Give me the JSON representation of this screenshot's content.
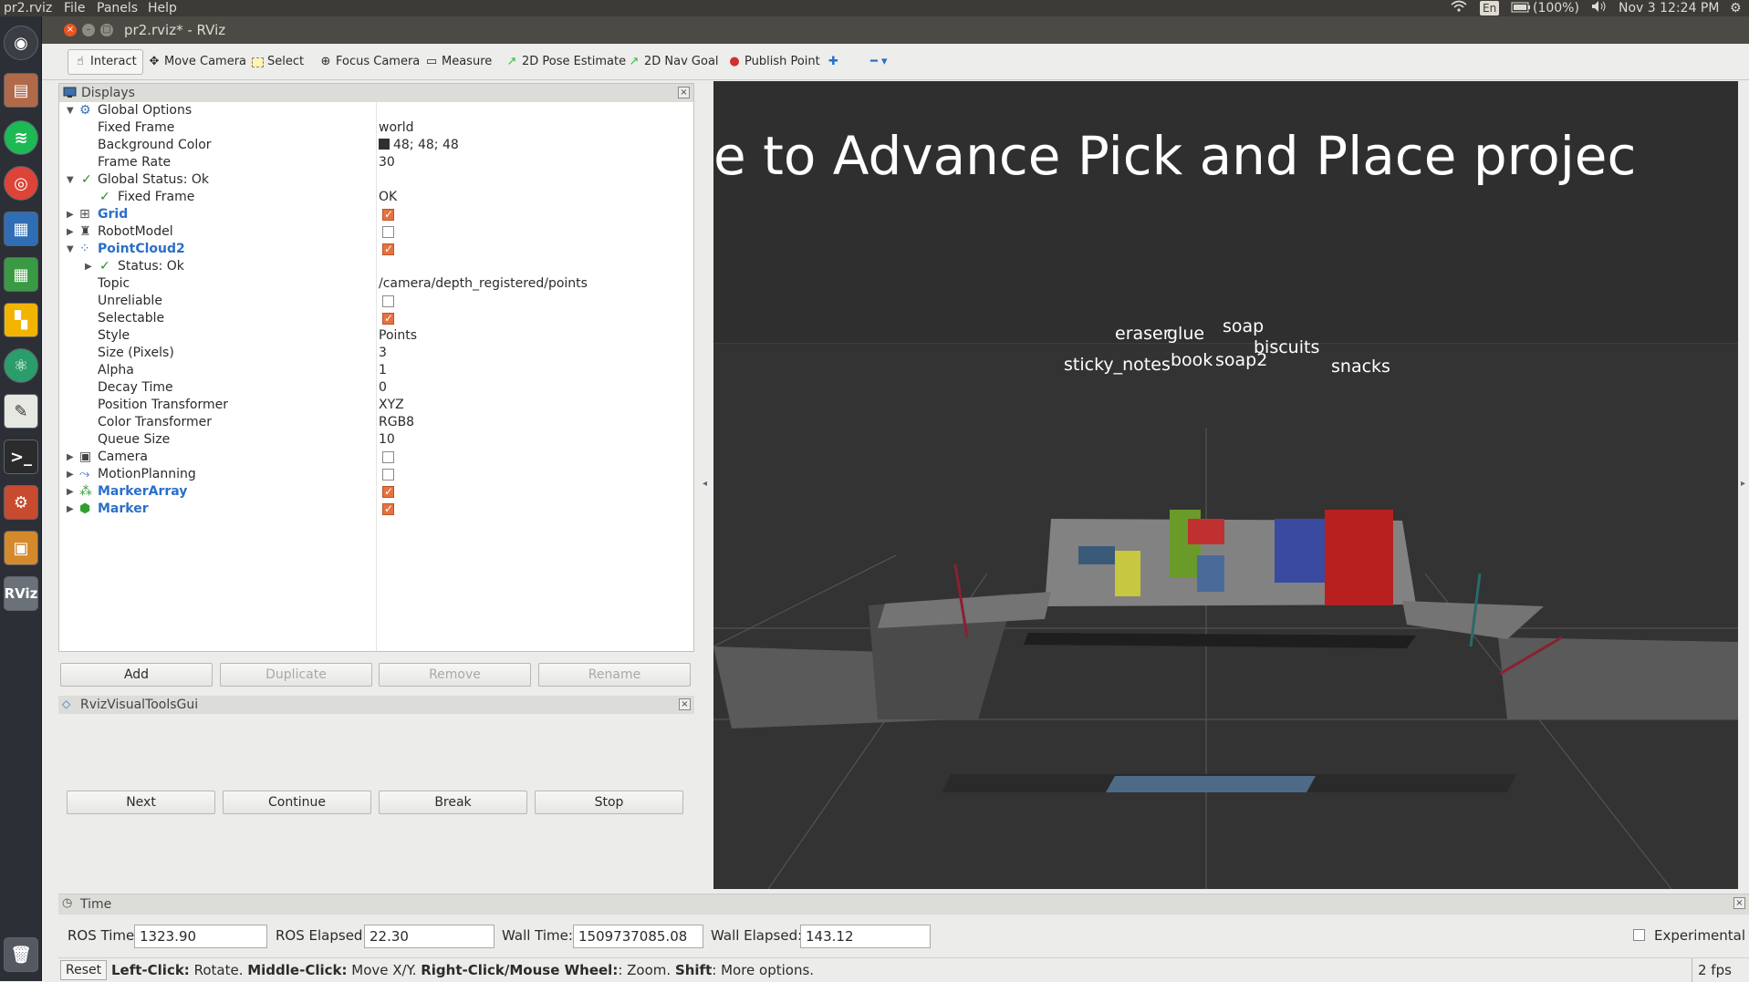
{
  "topbar": {
    "app_name": "pr2.rviz",
    "menus": [
      "File",
      "Panels",
      "Help"
    ],
    "keyboard": "En",
    "battery": "(100%)",
    "datetime": "Nov 3 12:24 PM"
  },
  "window": {
    "title": "pr2.rviz* - RViz"
  },
  "toolbar": {
    "interact": "Interact",
    "move_camera": "Move Camera",
    "select": "Select",
    "focus_camera": "Focus Camera",
    "measure": "Measure",
    "pose_estimate": "2D Pose Estimate",
    "nav_goal": "2D Nav Goal",
    "publish_point": "Publish Point"
  },
  "displays": {
    "header": "Displays",
    "rows": [
      {
        "name": "Global Options",
        "value": ""
      },
      {
        "name": "Fixed Frame",
        "value": "world"
      },
      {
        "name": "Background Color",
        "value": "48; 48; 48"
      },
      {
        "name": "Frame Rate",
        "value": "30"
      },
      {
        "name": "Global Status: Ok",
        "value": ""
      },
      {
        "name": "Fixed Frame",
        "value": "OK"
      },
      {
        "name": "Grid",
        "value": ""
      },
      {
        "name": "RobotModel",
        "value": ""
      },
      {
        "name": "PointCloud2",
        "value": ""
      },
      {
        "name": "Status: Ok",
        "value": ""
      },
      {
        "name": "Topic",
        "value": "/camera/depth_registered/points"
      },
      {
        "name": "Unreliable",
        "value": ""
      },
      {
        "name": "Selectable",
        "value": ""
      },
      {
        "name": "Style",
        "value": "Points"
      },
      {
        "name": "Size (Pixels)",
        "value": "3"
      },
      {
        "name": "Alpha",
        "value": "1"
      },
      {
        "name": "Decay Time",
        "value": "0"
      },
      {
        "name": "Position Transformer",
        "value": "XYZ"
      },
      {
        "name": "Color Transformer",
        "value": "RGB8"
      },
      {
        "name": "Queue Size",
        "value": "10"
      },
      {
        "name": "Camera",
        "value": ""
      },
      {
        "name": "MotionPlanning",
        "value": ""
      },
      {
        "name": "MarkerArray",
        "value": ""
      },
      {
        "name": "Marker",
        "value": ""
      }
    ],
    "buttons": {
      "add": "Add",
      "duplicate": "Duplicate",
      "remove": "Remove",
      "rename": "Rename"
    }
  },
  "vtools": {
    "header": "RvizVisualToolsGui",
    "next": "Next",
    "continue": "Continue",
    "break": "Break",
    "stop": "Stop"
  },
  "viewport": {
    "banner": "e  to  Advance  Pick  and  Place  projec",
    "labels": {
      "eraser": "eraser",
      "glue": "glue",
      "soap": "soap",
      "biscuits": "biscuits",
      "sticky_notes": "sticky_notes",
      "book": "book",
      "soap2": "soap2",
      "snacks": "snacks"
    }
  },
  "time": {
    "header": "Time",
    "ros_time_label": "ROS Time:",
    "ros_time": "1323.90",
    "ros_elapsed_label": "ROS Elapsed:",
    "ros_elapsed": "22.30",
    "wall_time_label": "Wall Time:",
    "wall_time": "1509737085.08",
    "wall_elapsed_label": "Wall Elapsed:",
    "wall_elapsed": "143.12",
    "experimental": "Experimental"
  },
  "status": {
    "reset": "Reset",
    "k1": "Left-Click:",
    "t1": " Rotate. ",
    "k2": "Middle-Click:",
    "t2": " Move X/Y. ",
    "k3": "Right-Click/Mouse Wheel:",
    "t3": ": Zoom. ",
    "k4": "Shift",
    "t4": ": More options.",
    "fps": "2 fps"
  },
  "launcher": [
    "RViz"
  ]
}
